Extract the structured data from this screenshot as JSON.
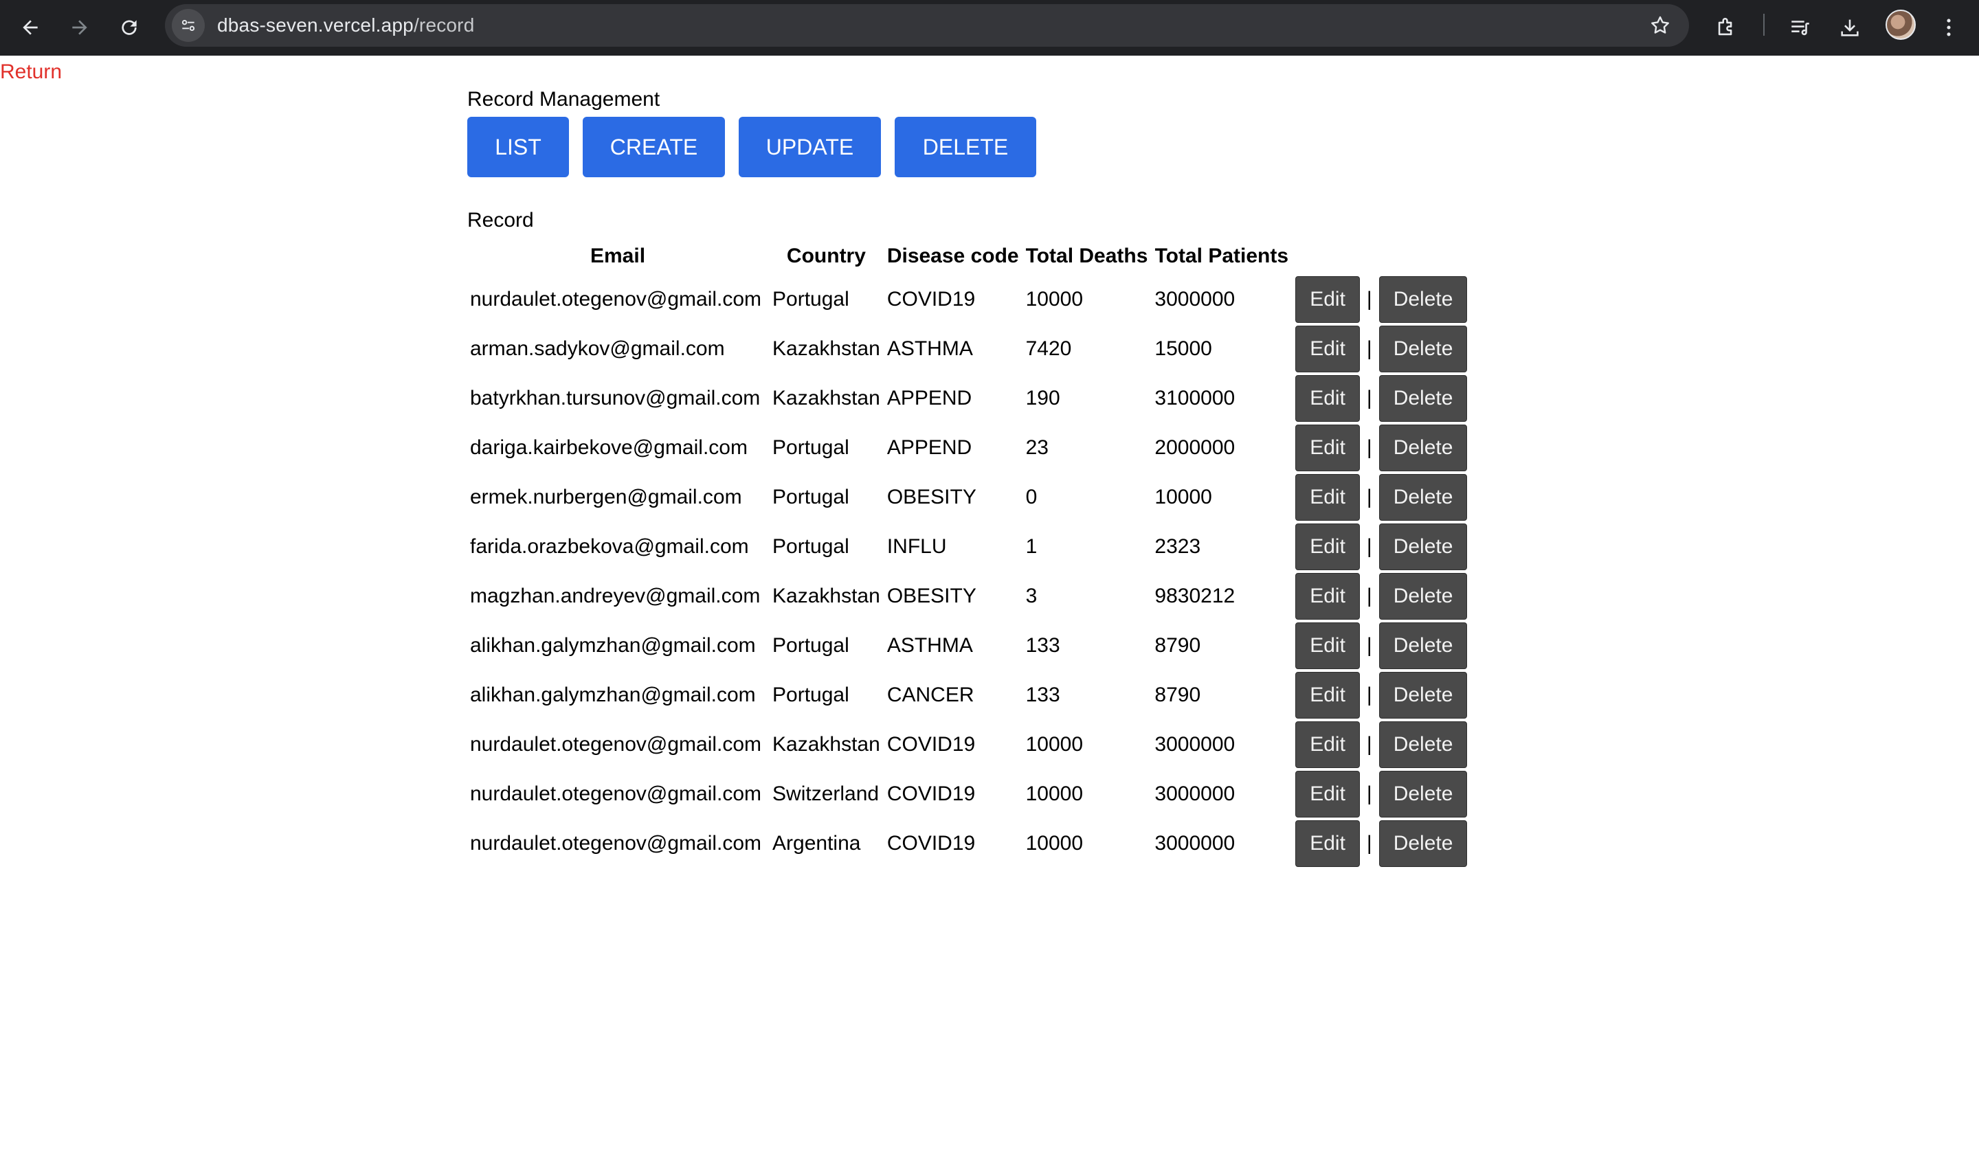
{
  "browser": {
    "url_host": "dbas-seven.vercel.app",
    "url_path": "/record"
  },
  "page": {
    "return_label": "Return",
    "heading": "Record Management",
    "buttons": [
      "LIST",
      "CREATE",
      "UPDATE",
      "DELETE"
    ],
    "section_label": "Record"
  },
  "table": {
    "headers": [
      "Email",
      "Country",
      "Disease code",
      "Total Deaths",
      "Total Patients"
    ],
    "edit_label": "Edit",
    "separator": "|",
    "delete_label": "Delete",
    "rows": [
      {
        "email": "nurdaulet.otegenov@gmail.com",
        "country": "Portugal",
        "disease_code": "COVID19",
        "total_deaths": "10000",
        "total_patients": "3000000"
      },
      {
        "email": "arman.sadykov@gmail.com",
        "country": "Kazakhstan",
        "disease_code": "ASTHMA",
        "total_deaths": "7420",
        "total_patients": "15000"
      },
      {
        "email": "batyrkhan.tursunov@gmail.com",
        "country": "Kazakhstan",
        "disease_code": "APPEND",
        "total_deaths": "190",
        "total_patients": "3100000"
      },
      {
        "email": "dariga.kairbekove@gmail.com",
        "country": "Portugal",
        "disease_code": "APPEND",
        "total_deaths": "23",
        "total_patients": "2000000"
      },
      {
        "email": "ermek.nurbergen@gmail.com",
        "country": "Portugal",
        "disease_code": "OBESITY",
        "total_deaths": "0",
        "total_patients": "10000"
      },
      {
        "email": "farida.orazbekova@gmail.com",
        "country": "Portugal",
        "disease_code": "INFLU",
        "total_deaths": "1",
        "total_patients": "2323"
      },
      {
        "email": "magzhan.andreyev@gmail.com",
        "country": "Kazakhstan",
        "disease_code": "OBESITY",
        "total_deaths": "3",
        "total_patients": "9830212"
      },
      {
        "email": "alikhan.galymzhan@gmail.com",
        "country": "Portugal",
        "disease_code": "ASTHMA",
        "total_deaths": "133",
        "total_patients": "8790"
      },
      {
        "email": "alikhan.galymzhan@gmail.com",
        "country": "Portugal",
        "disease_code": "CANCER",
        "total_deaths": "133",
        "total_patients": "8790"
      },
      {
        "email": "nurdaulet.otegenov@gmail.com",
        "country": "Kazakhstan",
        "disease_code": "COVID19",
        "total_deaths": "10000",
        "total_patients": "3000000"
      },
      {
        "email": "nurdaulet.otegenov@gmail.com",
        "country": "Switzerland",
        "disease_code": "COVID19",
        "total_deaths": "10000",
        "total_patients": "3000000"
      },
      {
        "email": "nurdaulet.otegenov@gmail.com",
        "country": "Argentina",
        "disease_code": "COVID19",
        "total_deaths": "10000",
        "total_patients": "3000000"
      }
    ]
  },
  "colors": {
    "chrome_bg": "#202124",
    "accent_button": "#2b6be4",
    "action_button": "#4a4a4a",
    "return_link": "#e1302a"
  },
  "icons": [
    "back-arrow-icon",
    "forward-arrow-icon",
    "reload-icon",
    "site-info-icon",
    "bookmark-star-icon",
    "extensions-icon",
    "reading-list-icon",
    "download-icon",
    "avatar",
    "kebab-menu-icon"
  ]
}
